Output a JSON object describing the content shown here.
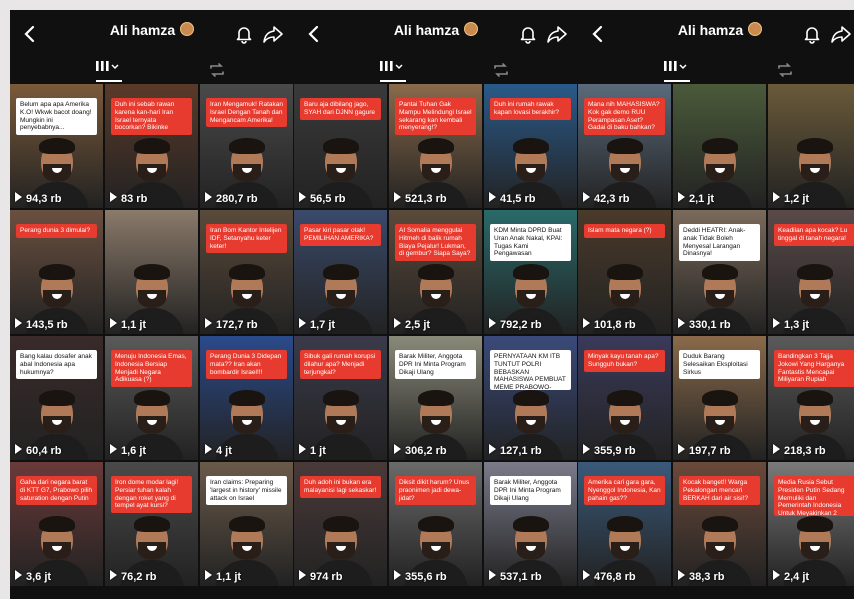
{
  "profile": {
    "name": "Ali hamza",
    "emoji_icon": "man-face-emoji-icon"
  },
  "icons": {
    "back": "chevron-left-icon",
    "bell": "bell-icon",
    "share": "share-arrow-icon",
    "grid": "grid-icon",
    "repost": "repost-icon"
  },
  "panels": [
    {
      "tiles": [
        {
          "views": "94,3 rb",
          "caption": "Belum apa apa Amerika K.O! Wkwk bacot doang! Mungkin ini penyebabnya...",
          "cap_style": "white",
          "bg": "#7a5a3a"
        },
        {
          "views": "83 rb",
          "caption": "Duh ini sebab rawan karena kan-hari Iran Israel ternyata bocorkan? Bikinke",
          "cap_style": "red",
          "bg": "#5a3a2a"
        },
        {
          "views": "280,7 rb",
          "caption": "Iran Mengamuk! Ratakan Israel Dengan Tanah dan Mengancam Amerika!",
          "cap_style": "red",
          "bg": "#4a4a4a"
        },
        {
          "views": "143,5 rb",
          "caption": "Perang dunia 3 dimulai?",
          "cap_style": "red",
          "bg": "#6a5040"
        },
        {
          "views": "1,1 jt",
          "caption": "",
          "cap_style": "none",
          "bg": "#8a7a6a"
        },
        {
          "views": "172,7 rb",
          "caption": "Iran Bom Kantor Intelijen IDF, Setanyahu keter keter!",
          "cap_style": "red",
          "bg": "#5a4a3a"
        },
        {
          "views": "60,4 rb",
          "caption": "Bang kalau dosafer anak abal Indonesia apa hukumnya?",
          "cap_style": "white",
          "bg": "#3a2a2a"
        },
        {
          "views": "1,6 jt",
          "caption": "Menuju Indonesia Emas, Indonesia Bersiap Menjadi Negara Adikuasa (?)",
          "cap_style": "red",
          "bg": "#5a5a5a"
        },
        {
          "views": "4 jt",
          "caption": "Perang Dunia 3 Didepan mata?? Iran akan bombardir Israel!!!",
          "cap_style": "red",
          "bg": "#2a4a8a"
        },
        {
          "views": "3,6 jt",
          "caption": "Gaha dari negara barat di KTT G7, Prabowo pilih saturation dengan Putin",
          "cap_style": "red",
          "bg": "#6a3a3a"
        },
        {
          "views": "76,2 rb",
          "caption": "Iron dome modar lagi! Persiar tuhan kalah dengan roket yang di tempel ayat kursi?",
          "cap_style": "red",
          "bg": "#4a4a4a"
        },
        {
          "views": "1,1 jt",
          "caption": "Iran claims: Preparing 'largest in history' missile attack on Israel",
          "cap_style": "white",
          "bg": "#6a5a4a"
        }
      ]
    },
    {
      "tiles": [
        {
          "views": "56,5 rb",
          "caption": "Baru aja dibilang jago, SYAH dari DJNN gagure",
          "cap_style": "red",
          "bg": "#3a3a3a"
        },
        {
          "views": "521,3 rb",
          "caption": "Pantai Tuhan Gak Mampu Melindungi Israel sekarang kan kembali menyerang!?",
          "cap_style": "red",
          "bg": "#8a6a4a"
        },
        {
          "views": "41,5 rb",
          "caption": "Duh ini rumah rawak kapan lovasi berakhir?",
          "cap_style": "red",
          "bg": "#2a5a8a"
        },
        {
          "views": "1,7 jt",
          "caption": "Pasar kiri pasar otak! PEMILIHAN AMERIKA?",
          "cap_style": "red",
          "bg": "#3a4a6a"
        },
        {
          "views": "2,5 jt",
          "caption": "AI Somalia menggulai Hitmeh di balik rumah Biaya Pejalur! Lukman, di gembur? Siapa Saya?",
          "cap_style": "red",
          "bg": "#5a4a3a"
        },
        {
          "views": "792,2 rb",
          "caption": "KDM Minta DPRD Buat Uran Anak Nakal, KPAI: Tugas Kami Pengawasan",
          "cap_style": "white",
          "bg": "#2a6a6a"
        },
        {
          "views": "1 jt",
          "caption": "Sibuk gali rumah korupsi dilahur apa? Menjadi terjungkal?",
          "cap_style": "red",
          "bg": "#3a3a4a"
        },
        {
          "views": "306,2 rb",
          "caption": "Barak Militer, Anggota DPR Ini Minta Program Dikaji Ulang",
          "cap_style": "white",
          "bg": "#8a8a7a"
        },
        {
          "views": "127,1 rb",
          "caption": "PERNYATAAN KM ITB TUNTUT POLRI BEBASKAN MAHASISWA PEMBUAT MEME PRABOWO-JOKOWI",
          "cap_style": "white",
          "bg": "#3a4a7a"
        },
        {
          "views": "974 rb",
          "caption": "Duh adoh ini bukan era malayanisi lagi sekaskar!",
          "cap_style": "red",
          "bg": "#4a3a3a"
        },
        {
          "views": "355,6 rb",
          "caption": "Diksit dikit harum? Unus praonimen jadi dewa-jidat?",
          "cap_style": "red",
          "bg": "#6a6a6a"
        },
        {
          "views": "537,1 rb",
          "caption": "Barak Militer, Anggota DPR Ini Minta Program Dikaji Ulang",
          "cap_style": "white",
          "bg": "#7a7a8a"
        }
      ]
    },
    {
      "tiles": [
        {
          "views": "42,3 rb",
          "caption": "Mana nih MAHASISWA? Kok gak demo RUU Perampasan Aset? Gadai di baku bahkan?",
          "cap_style": "red",
          "bg": "#5a6a7a"
        },
        {
          "views": "2,1 jt",
          "caption": "",
          "cap_style": "none",
          "bg": "#4a5a3a"
        },
        {
          "views": "1,2 jt",
          "caption": "",
          "cap_style": "none",
          "bg": "#6a5a3a"
        },
        {
          "views": "101,8 rb",
          "caption": "Islam mata negara (?)",
          "cap_style": "red",
          "bg": "#4a3a2a"
        },
        {
          "views": "330,1 rb",
          "caption": "Deddi HEATRI: Anak-anak Tidak Boleh Menyesal Larangan Dinasnya!",
          "cap_style": "white",
          "bg": "#7a6a5a"
        },
        {
          "views": "1,3 jt",
          "caption": "Keadilan apa kocak? Lu tinggal di tanah negara!",
          "cap_style": "red",
          "bg": "#5a4a4a"
        },
        {
          "views": "355,9 rb",
          "caption": "Minyak kayu tanah apa? Sungguh bukan?",
          "cap_style": "red",
          "bg": "#3a3a5a"
        },
        {
          "views": "197,7 rb",
          "caption": "Duduk Barang Selesaikan Eksploitasi Sirkus",
          "cap_style": "white",
          "bg": "#8a6a4a"
        },
        {
          "views": "218,3 rb",
          "caption": "Bandingkan 3 Tajja Jokowi Yang Harganya Fantastis Mencapai Miliyaran Rupiah",
          "cap_style": "red",
          "bg": "#5a5a5a"
        },
        {
          "views": "476,8 rb",
          "caption": "Amerika cari gara gara, Nyenggol Indonesia, Kan pahain gas??",
          "cap_style": "red",
          "bg": "#3a5a7a"
        },
        {
          "views": "38,3 rb",
          "caption": "Kocak banget!! Warga Pekalongan mencari BERKAH dari air sisi!?",
          "cap_style": "red",
          "bg": "#6a4a3a"
        },
        {
          "views": "2,4 jt",
          "caption": "Media Rusia Sebut Presiden Putin Sedang Memuliki dan Pemerintah Indonesia Untuk Meyakinkan 2 Pesawat Tempur Tujuan Kemitraan",
          "cap_style": "red",
          "bg": "#7a7a7a"
        }
      ]
    }
  ]
}
